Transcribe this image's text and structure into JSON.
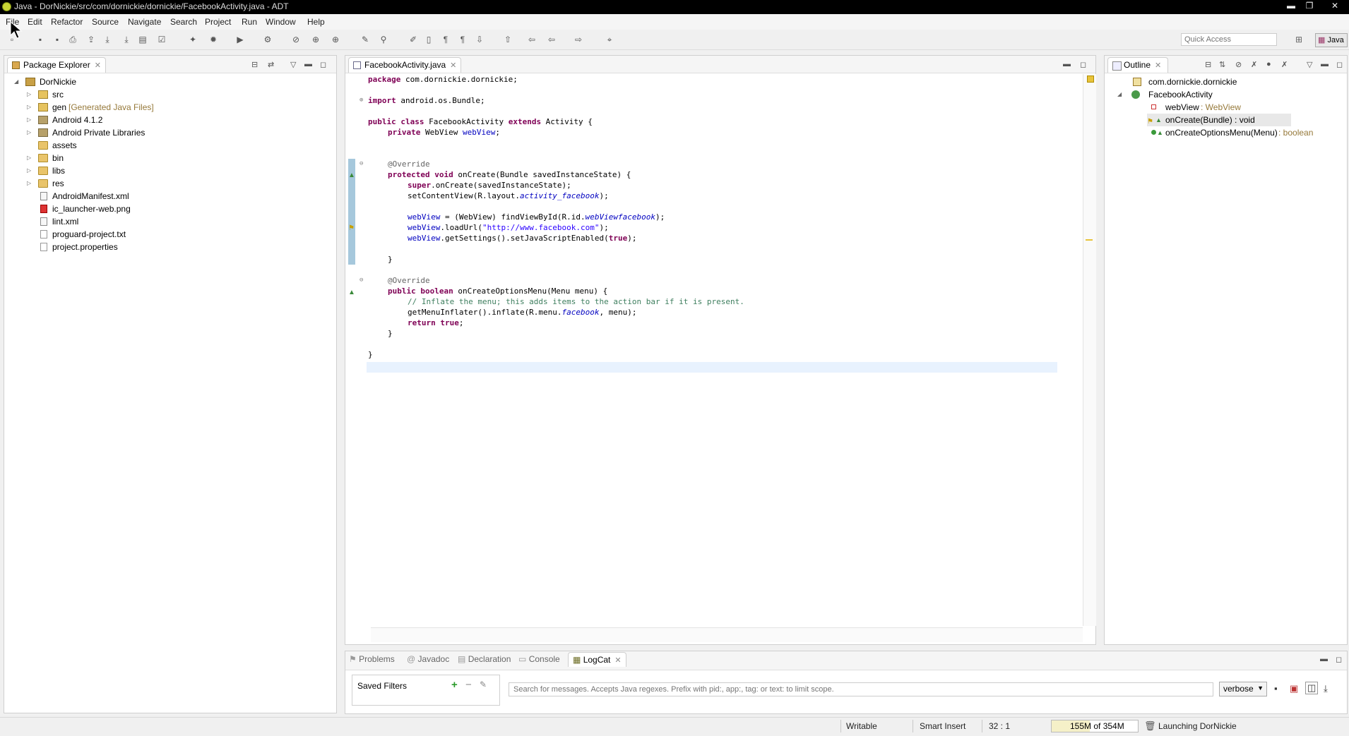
{
  "window": {
    "title": "Java - DorNickie/src/com/dornickie/dornickie/FacebookActivity.java - ADT"
  },
  "menubar": {
    "items": [
      "File",
      "Edit",
      "Refactor",
      "Source",
      "Navigate",
      "Search",
      "Project",
      "Run",
      "Window",
      "Help"
    ]
  },
  "toolbar": {
    "quick_access_placeholder": "Quick Access",
    "perspective": "Java"
  },
  "package_explorer": {
    "tab": "Package Explorer",
    "project": "DorNickie",
    "items": [
      {
        "label": "src",
        "note": ""
      },
      {
        "label": "gen",
        "note": "[Generated Java Files]"
      },
      {
        "label": "Android 4.1.2",
        "note": ""
      },
      {
        "label": "Android Private Libraries",
        "note": ""
      },
      {
        "label": "assets",
        "note": ""
      },
      {
        "label": "bin",
        "note": ""
      },
      {
        "label": "libs",
        "note": ""
      },
      {
        "label": "res",
        "note": ""
      },
      {
        "label": "AndroidManifest.xml",
        "note": ""
      },
      {
        "label": "ic_launcher-web.png",
        "note": ""
      },
      {
        "label": "lint.xml",
        "note": ""
      },
      {
        "label": "proguard-project.txt",
        "note": ""
      },
      {
        "label": "project.properties",
        "note": ""
      }
    ]
  },
  "editor": {
    "tab": "FacebookActivity.java",
    "lines": {
      "l1a": "package",
      "l1b": " com.dornickie.dornickie;",
      "l2a": "import",
      "l2b": " android.os.Bundle;",
      "l3a": "public class",
      "l3b": " FacebookActivity ",
      "l3c": "extends",
      "l3d": " Activity {",
      "l4a": "private",
      "l4b": " WebView ",
      "l4c": "webView",
      "l4d": ";",
      "l5": "@Override",
      "l6a": "protected void",
      "l6b": " onCreate(Bundle savedInstanceState) {",
      "l7a": "super",
      "l7b": ".onCreate(savedInstanceState);",
      "l8a": "setContentView(R.layout.",
      "l8b": "activity_facebook",
      "l8c": ");",
      "l9a": "webView",
      "l9b": " = (WebView) findViewById(R.id.",
      "l9c": "webViewfacebook",
      "l9d": ");",
      "l10a": "webView",
      "l10b": ".loadUrl(",
      "l10c": "\"http://www.facebook.com\"",
      "l10d": ");",
      "l11a": "webView",
      "l11b": ".getSettings().setJavaScriptEnabled(",
      "l11c": "true",
      "l11d": ");",
      "l12": "}",
      "l13": "@Override",
      "l14a": "public boolean",
      "l14b": " onCreateOptionsMenu(Menu menu) {",
      "l15": "// Inflate the menu; this adds items to the action bar if it is present.",
      "l16a": "getMenuInflater().inflate(R.menu.",
      "l16b": "facebook",
      "l16c": ", menu);",
      "l17a": "return true",
      "l17b": ";",
      "l18": "}",
      "l19": "}"
    }
  },
  "outline": {
    "tab": "Outline",
    "package": "com.dornickie.dornickie",
    "class": "FacebookActivity",
    "members": [
      {
        "name": "webView",
        "type": " : WebView"
      },
      {
        "name": "onCreate(Bundle) : void",
        "type": ""
      },
      {
        "name": "onCreateOptionsMenu(Menu)",
        "type": " : boolean"
      }
    ]
  },
  "bottom": {
    "tabs": [
      "Problems",
      "Javadoc",
      "Declaration",
      "Console",
      "LogCat"
    ],
    "saved_filters": "Saved Filters",
    "search_placeholder": "Search for messages. Accepts Java regexes. Prefix with pid:, app:, tag: or text: to limit scope.",
    "level": "verbose"
  },
  "status": {
    "writable": "Writable",
    "insert": "Smart Insert",
    "position": "32 : 1",
    "memory": "155M of 354M",
    "job": "Launching DorNickie"
  },
  "colors": {
    "keyword": "#7f0055",
    "string": "#2a00ff",
    "comment": "#3f7f5f",
    "field": "#0000c0"
  }
}
